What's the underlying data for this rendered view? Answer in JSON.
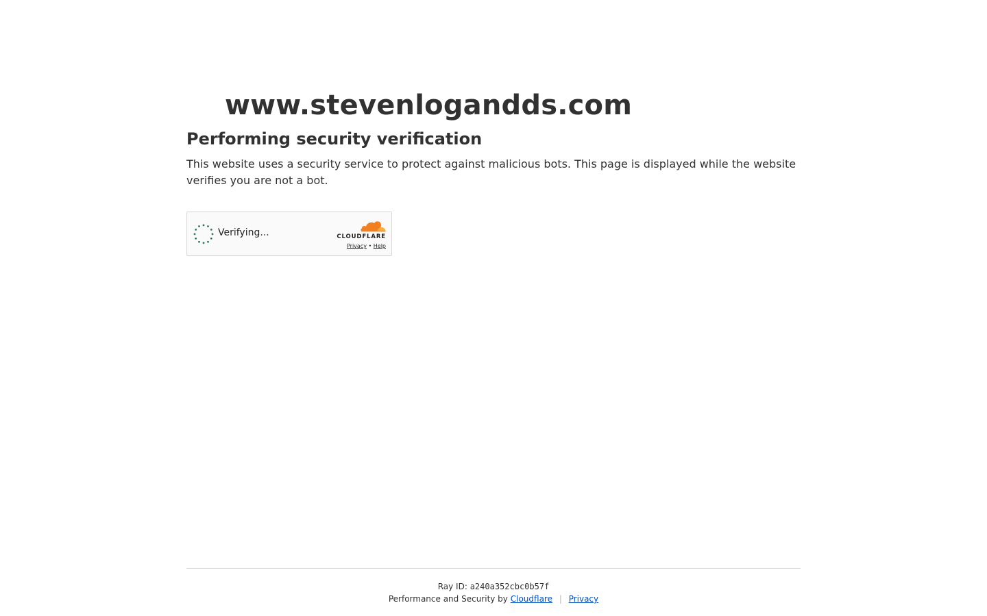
{
  "site": {
    "domain": "www.stevenlogandds.com"
  },
  "challenge": {
    "heading": "Performing security verification",
    "description": "This website uses a security service to protect against malicious bots. This page is displayed while the website verifies you are not a bot."
  },
  "widget": {
    "status_text": "Verifying...",
    "brand_name": "CLOUDFLARE",
    "privacy_link": "Privacy",
    "link_separator": "•",
    "help_link": "Help",
    "spinner_icon": "spinner-icon",
    "logo_icon": "cloudflare-cloud-icon",
    "colors": {
      "spinner": "#2c7a5b",
      "cloud_dark": "#f38020",
      "cloud_light": "#faae40"
    }
  },
  "footer": {
    "ray_label": "Ray ID:",
    "ray_id": "a240a352cbc0b57f",
    "performance_text": "Performance and Security by",
    "cloudflare_link": "Cloudflare",
    "separator": "|",
    "privacy_link": "Privacy",
    "link_color": "#0051c3"
  }
}
